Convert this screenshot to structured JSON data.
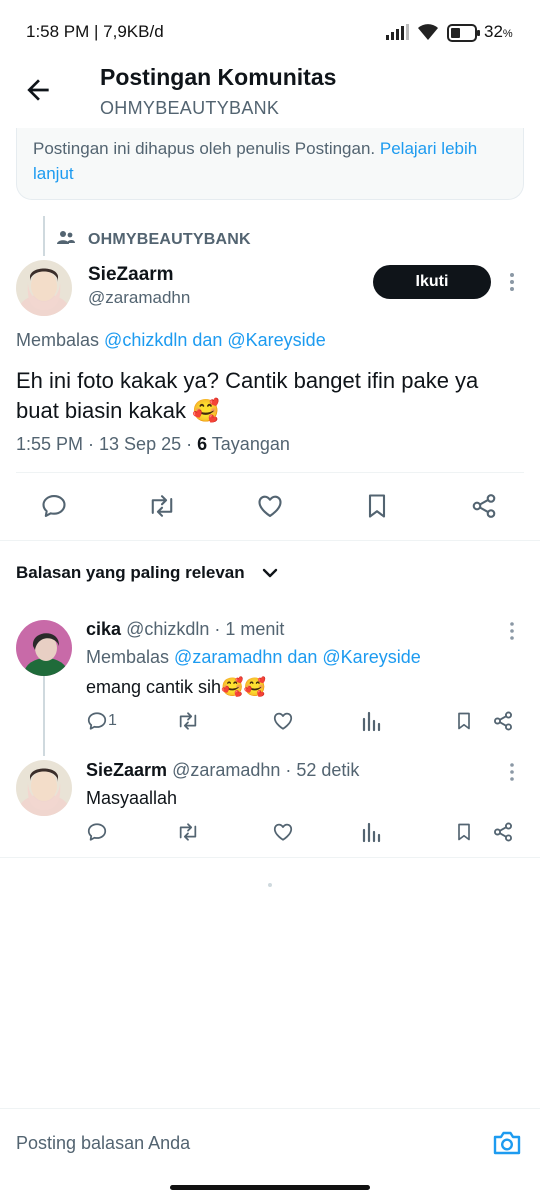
{
  "status_bar": {
    "time_data": "1:58 PM | 7,9KB/d",
    "signal_icon": "signal-icon",
    "wifi_icon": "wifi-icon",
    "battery_icon": "battery-icon",
    "battery_percent": "32"
  },
  "header": {
    "back_icon": "arrow-left-icon",
    "title": "Postingan Komunitas",
    "subtitle": "OHMYBEAUTYBANK"
  },
  "notice": {
    "text": "Postingan ini dihapus oleh penulis Postingan.",
    "link_text": "Pelajari lebih lanjut"
  },
  "main_post": {
    "community_icon": "people-icon",
    "community": "OHMYBEAUTYBANK",
    "author_name": "SieZaarm",
    "author_handle": "@zaramadhn",
    "follow_label": "Ikuti",
    "more_icon": "more-vertical-icon",
    "replying_prefix": "Membalas",
    "replying_to": "@chizkdln dan @Kareyside",
    "text": "Eh ini foto kakak ya? Cantik banget ifin pake ya buat biasin kakak 🥰",
    "time": "1:55 PM · 13 Sep 25 · ",
    "views_count": "6",
    "views_label": " Tayangan",
    "actions": [
      "reply-icon",
      "retweet-icon",
      "like-icon",
      "bookmark-icon",
      "share-icon"
    ]
  },
  "replies_sort": {
    "label": "Balasan yang paling relevan",
    "icon": "chevron-down-icon"
  },
  "replies": [
    {
      "name": "cika",
      "handle": "@chizkdln",
      "time": " · 1 menit",
      "replying_prefix": "Membalas",
      "replying_to": "@zaramadhn dan @Kareyside",
      "text": "emang cantik sih🥰🥰",
      "reply_count": "1"
    },
    {
      "name": "SieZaarm",
      "handle": "@zaramadhn",
      "time": " · 52 detik",
      "text": "Masyaallah",
      "reply_count": ""
    }
  ],
  "reply_bar": {
    "placeholder": "Posting balasan Anda",
    "camera_icon": "camera-icon"
  },
  "colors": {
    "accent": "#1d9bf0",
    "text": "#0f1419",
    "muted": "#536471",
    "follow_bg": "#0f1419"
  }
}
